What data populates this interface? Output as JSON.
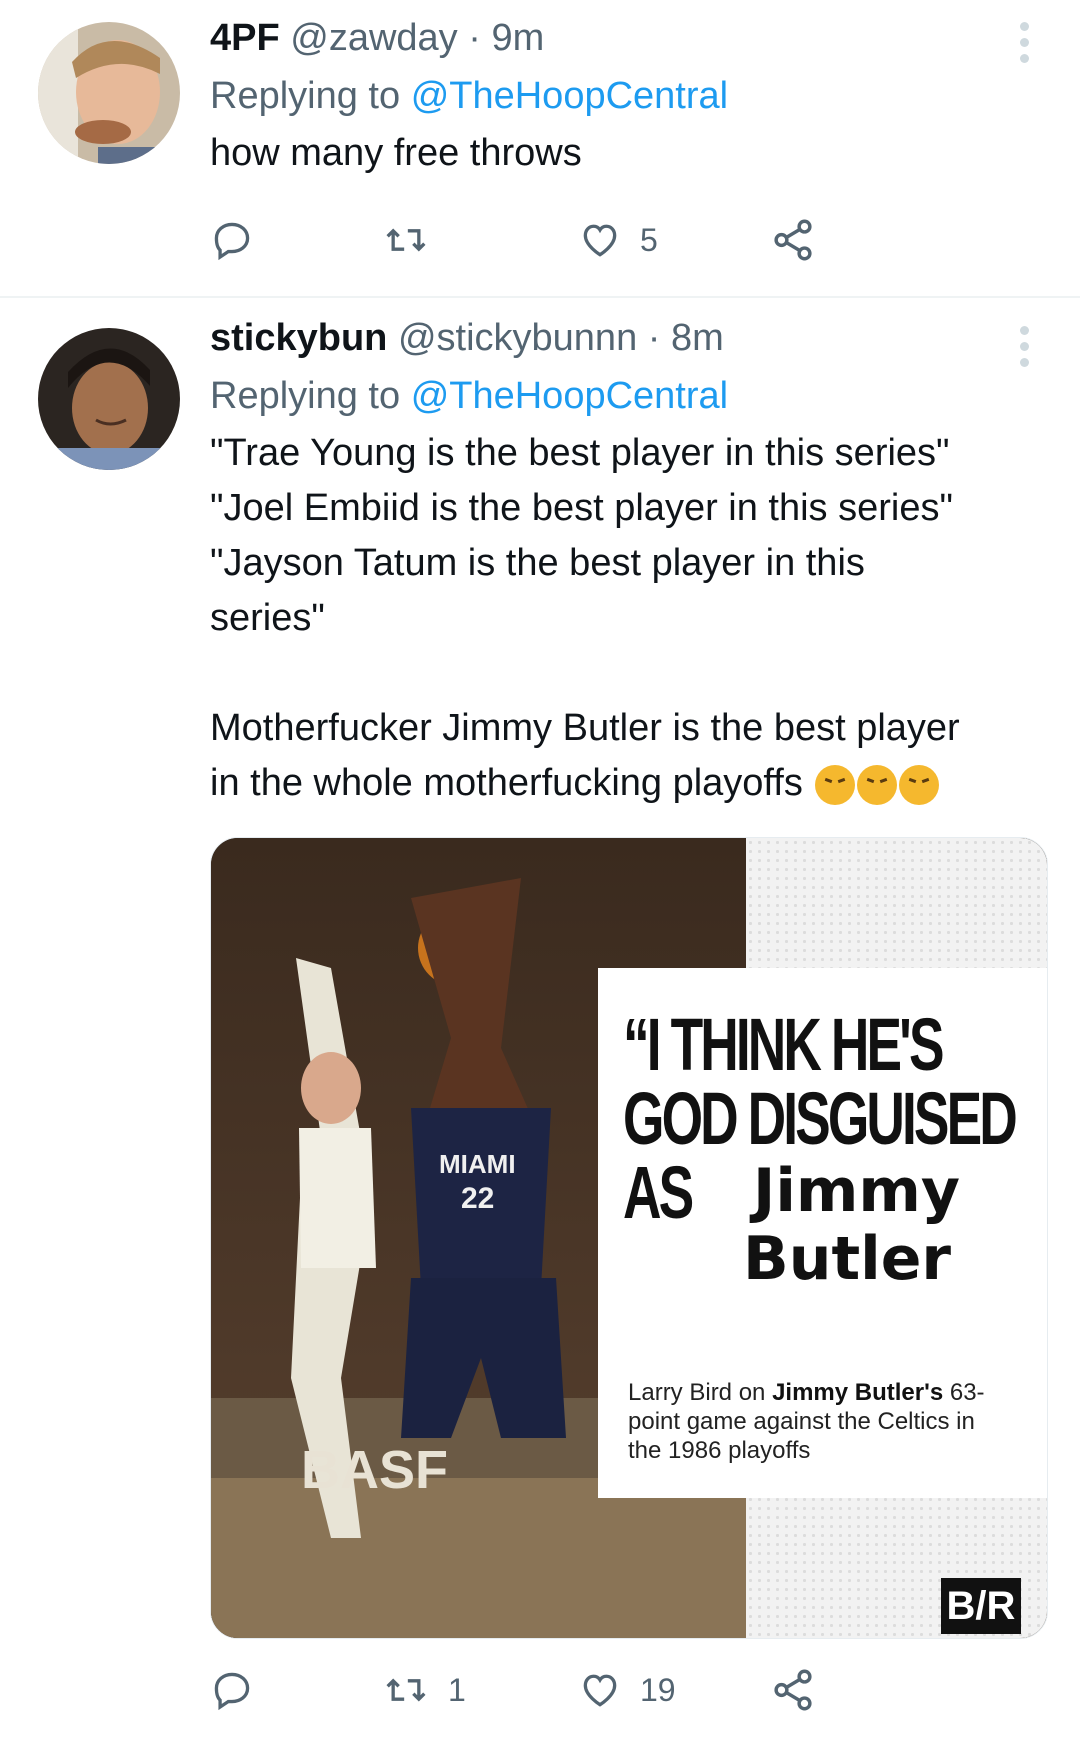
{
  "tweets": [
    {
      "display_name": "4PF",
      "handle": "@zawday",
      "separator": "·",
      "time": "9m",
      "replying_prefix": "Replying to",
      "replying_to": "@TheHoopCentral",
      "text": "how many free throws",
      "reply_count": "",
      "retweet_count": "",
      "like_count": "5"
    },
    {
      "display_name": "stickybun",
      "handle": "@stickybunnn",
      "separator": "·",
      "time": "8m",
      "replying_prefix": "Replying to",
      "replying_to": "@TheHoopCentral",
      "text_lines": [
        "\"Trae Young is the best player in this series\"",
        "\"Joel Embiid is the best player in this series\"",
        "\"Jayson Tatum is the best player in this",
        "series\"",
        "",
        "Motherfucker Jimmy Butler is the best player",
        "in the whole motherfucking playoffs"
      ],
      "emoji_names": [
        "face-with-steam-icon",
        "face-with-steam-icon",
        "face-with-steam-icon"
      ],
      "media": {
        "quote_line1": "“I THINK HE'S",
        "quote_line2": "GOD DISGUISED",
        "quote_line3": "AS",
        "quote_name1": "Jimmy",
        "quote_name2": "Butler",
        "caption_plain1": "Larry Bird on ",
        "caption_bold": "Jimmy Butler's",
        "caption_plain2": "63-point game against the Celtics in the 1986 playoffs",
        "logo": "B/R",
        "jersey_team": "MIAMI",
        "jersey_number": "22",
        "court_sponsor": "BASF"
      },
      "reply_count": "",
      "retweet_count": "1",
      "like_count": "19"
    }
  ],
  "colors": {
    "link": "#1d9bf0",
    "secondary": "#536471",
    "primary_text": "#0f1419",
    "divider": "#eff3f4"
  }
}
